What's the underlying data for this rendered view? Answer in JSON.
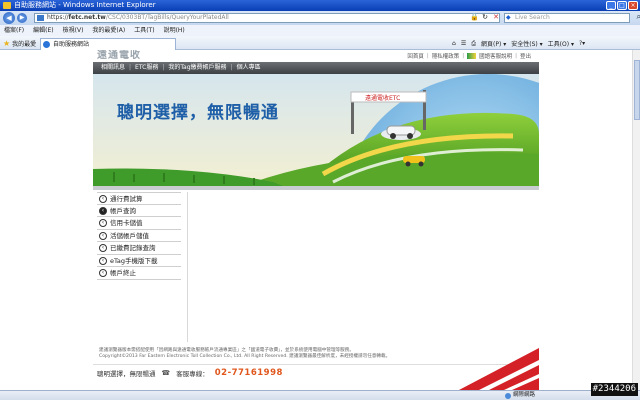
{
  "window": {
    "title": "自助服務網站 - Windows Internet Explorer",
    "min_label": "_",
    "max_label": "□",
    "close_label": "×"
  },
  "address": {
    "back_label": "◀",
    "forward_label": "▶",
    "host": "fetc.net.tw",
    "prefix": "https://",
    "path": "/CSC/0303BT/TagBills/QueryYourPlatedAll",
    "lock_icon": "lock-icon",
    "lock_glyph": "🔒",
    "refresh_glyph": "↻",
    "stop_glyph": "✕",
    "search_placeholder": "Live Search",
    "search_logo": "◆",
    "search_glyph": "⌕"
  },
  "menubar": [
    "檔案(F)",
    "編輯(E)",
    "檢視(V)",
    "我的最愛(A)",
    "工具(T)",
    "說明(H)"
  ],
  "favorites": {
    "star_glyph": "★",
    "label": "我的最愛",
    "tab_title": "自助服務網站"
  },
  "commandbar": {
    "home_glyph": "⌂",
    "feed_glyph": "☰",
    "print_glyph": "⎙",
    "page_label": "網頁(P) ▾",
    "safety_label": "安全性(S) ▾",
    "tools_label": "工具(O) ▾",
    "help_glyph": "?▾"
  },
  "site": {
    "logo_text": "遠通電收",
    "toplinks": [
      "回首頁",
      "隱私權政策",
      "國語客服說明",
      "登出"
    ],
    "nav_items": [
      "相關訊息",
      "ETC服務",
      "我的Tag繳費帳戶服務",
      "個人專區"
    ],
    "banner_text": "聰明選擇，無限暢通",
    "sign_text": "遠通電收ETC",
    "side_menu": [
      {
        "label": "通行費試算",
        "active": false
      },
      {
        "label": "帳戶查詢",
        "active": true
      },
      {
        "label": "信用卡儲值",
        "active": false
      },
      {
        "label": "活儲帳戶儲值",
        "active": false
      },
      {
        "label": "已繳費記錄查詢",
        "active": false
      },
      {
        "label": "eTag手機版下載",
        "active": false
      },
      {
        "label": "帳戶終止",
        "active": false
      }
    ],
    "chevron_glyph": "‹",
    "footer_line1": "建議瀏覽器版本需搭配使用「因網路與遠通電收服務帳戶流通專業區」之「國道電子收費」，並於系統使用電腦中管理等服務。",
    "footer_line2": "Copyright©2013 Far Eastern Electronic Toll Collection Co., Ltd. All Right Reserved. 建議瀏覽器最佳解析度，未經授權請勿任意轉載。",
    "hotline_slogan": "聰明選擇，無限暢通",
    "hotline_icon": "☎",
    "hotline_label": "客服專線：",
    "hotline_number": "02-77161998"
  },
  "statusbar": {
    "zone": "網際網路",
    "zoom": "100% ▾"
  },
  "watermark": "#2344206",
  "colors": {
    "accent_blue": "#1f5fa8",
    "nav_gray": "#4a4e52",
    "hotline_orange": "#e0561c",
    "stripe_red": "#d42027"
  }
}
